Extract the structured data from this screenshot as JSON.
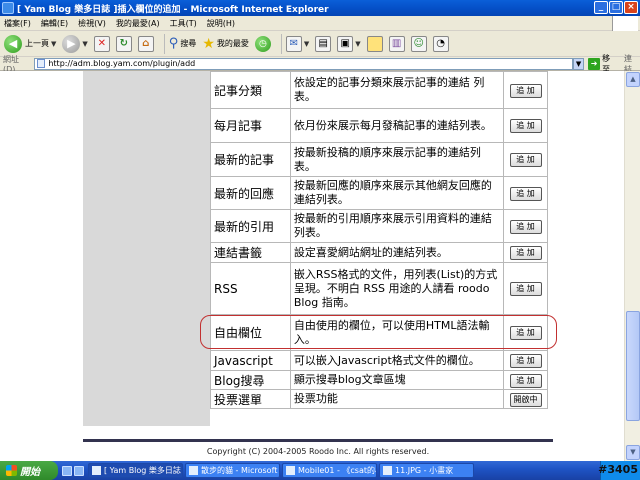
{
  "window": {
    "title": "[ Yam Blog 樂多日誌 ]插入欄位的追加 - Microsoft Internet Explorer",
    "minimize": "_",
    "maximize": "□",
    "close": "×"
  },
  "menu": [
    "檔案(F)",
    "編輯(E)",
    "檢視(V)",
    "我的最愛(A)",
    "工具(T)",
    "說明(H)"
  ],
  "toolbar": {
    "back_label": "上一頁",
    "search_label": "搜尋",
    "favorites_label": "我的最愛"
  },
  "address": {
    "label": "網址(D)",
    "url": "http://adm.blog.yam.com/plugin/add",
    "go_label": "移至",
    "links_label": "連結"
  },
  "plugins": [
    {
      "name": "記事分類",
      "desc": "依設定的記事分類來展示記事的連結 列表。",
      "action": "追 加"
    },
    {
      "name": "每月記事",
      "desc": "依月份來展示每月發稿記事的連結列表。",
      "action": "追 加"
    },
    {
      "name": "最新的記事",
      "desc": "按最新投稿的順序來展示記事的連結列表。",
      "action": "追 加"
    },
    {
      "name": "最新的回應",
      "desc": "按最新回應的順序來展示其他網友回應的連結列表。",
      "action": "追 加"
    },
    {
      "name": "最新的引用",
      "desc": "按最新的引用順序來展示引用資料的連結列表。",
      "action": "追 加"
    },
    {
      "name": "連結書籤",
      "desc": "設定喜愛網站網址的連結列表。",
      "action": "追 加"
    },
    {
      "name": "RSS",
      "desc": "嵌入RSS格式的文件，用列表(List)的方式呈現。不明白 RSS 用途的人請看 roodo Blog 指南。",
      "action": "追 加"
    },
    {
      "name": "自由欄位",
      "desc": "自由使用的欄位，可以使用HTML語法輸入。",
      "action": "追 加"
    },
    {
      "name": "Javascript",
      "desc": "可以嵌入Javascript格式文件的欄位。",
      "action": "追 加"
    },
    {
      "name": "Blog搜尋",
      "desc": "顯示搜尋blog文章區塊",
      "action": "追 加"
    },
    {
      "name": "投票選單",
      "desc": "投票功能",
      "action": "開啟中"
    }
  ],
  "footer": {
    "copyright": "Copyright (C) 2004-2005 Roodo Inc. All rights reserved."
  },
  "taskbar": {
    "start_label": "開始",
    "tasks": [
      "[ Yam Blog 樂多日誌 ...",
      "散步的貓 - Microsoft ...",
      "Mobile01 - 《csat的小...",
      "11.JPG - 小畫家"
    ]
  },
  "stamp": "#3405"
}
